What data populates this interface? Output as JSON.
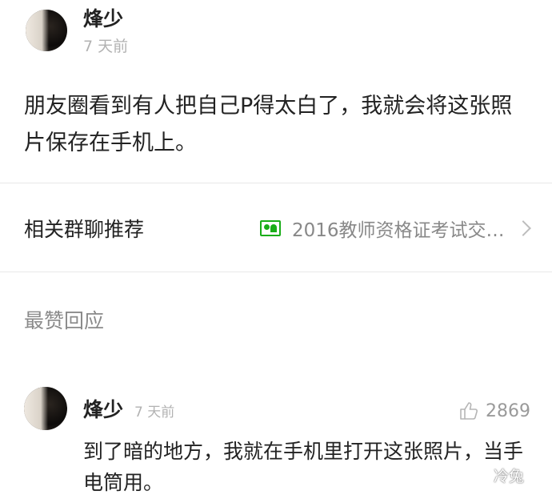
{
  "post": {
    "author": "烽少",
    "time": "7 天前",
    "body": "朋友圈看到有人把自己P得太白了，我就会将这张照片保存在手机上。"
  },
  "related": {
    "label": "相关群聊推荐",
    "group_name": "2016教师资格证考试交…",
    "group_icon": "group-chat-icon",
    "accent_color": "#1aad19"
  },
  "section": {
    "title": "最赞回应"
  },
  "reply": {
    "author": "烽少",
    "time": "7 天前",
    "likes": "2869",
    "body": "到了暗的地方，我就在手机里打开这张照片，当手电筒用。"
  },
  "watermark": {
    "text": "冷兔"
  }
}
